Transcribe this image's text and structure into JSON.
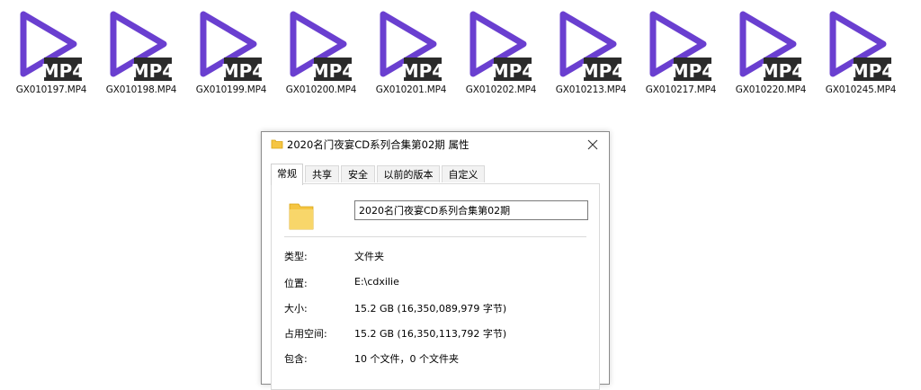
{
  "files": [
    {
      "name": "GX010197.MP4"
    },
    {
      "name": "GX010198.MP4"
    },
    {
      "name": "GX010199.MP4"
    },
    {
      "name": "GX010200.MP4"
    },
    {
      "name": "GX010201.MP4"
    },
    {
      "name": "GX010202.MP4"
    },
    {
      "name": "GX010213.MP4"
    },
    {
      "name": "GX010217.MP4"
    },
    {
      "name": "GX010220.MP4"
    },
    {
      "name": "GX010245.MP4"
    }
  ],
  "icon": {
    "badge": "MP4",
    "name": "play-mp4-icon",
    "stroke_color": "#6a3fd0",
    "badge_color": "#2b2b2b"
  },
  "dialog": {
    "title": "2020名门夜宴CD系列合集第02期 属性",
    "tabs": [
      {
        "label": "常规",
        "active": true
      },
      {
        "label": "共享",
        "active": false
      },
      {
        "label": "安全",
        "active": false
      },
      {
        "label": "以前的版本",
        "active": false
      },
      {
        "label": "自定义",
        "active": false
      }
    ],
    "folder_name": "2020名门夜宴CD系列合集第02期",
    "properties": [
      {
        "label": "类型:",
        "value": "文件夹"
      },
      {
        "label": "位置:",
        "value": "E:\\cdxilie"
      },
      {
        "label": "大小:",
        "value": "15.2 GB (16,350,089,979 字节)"
      },
      {
        "label": "占用空间:",
        "value": "15.2 GB (16,350,113,792 字节)"
      },
      {
        "label": "包含:",
        "value": "10 个文件，0 个文件夹"
      }
    ]
  }
}
